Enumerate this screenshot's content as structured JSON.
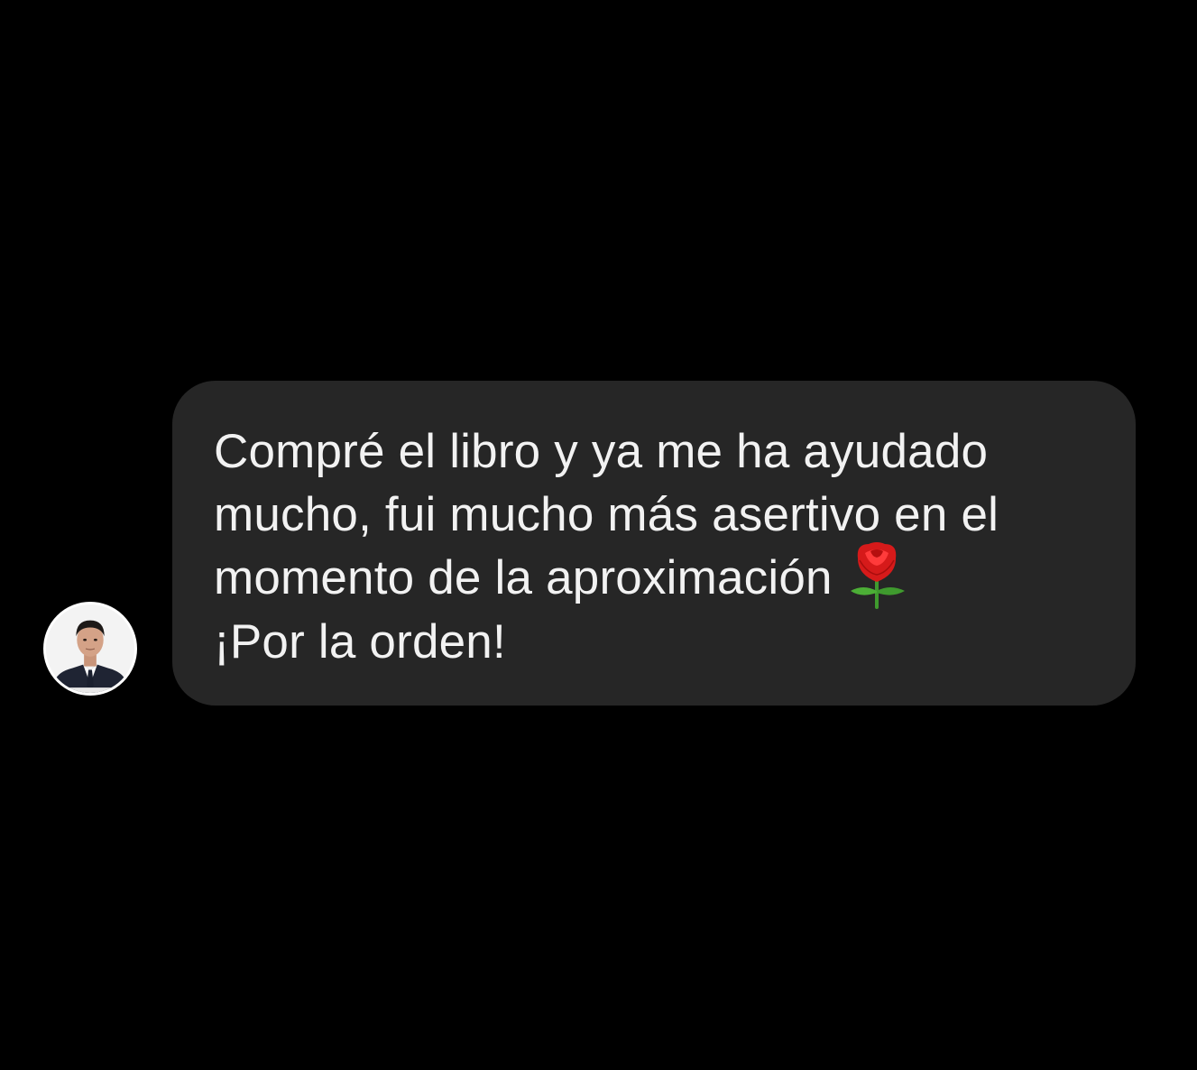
{
  "conversation": {
    "message": {
      "lines": [
        "Compré el libro y ya me ha ayudado",
        "mucho, fui mucho más asertivo en el",
        "momento de la aproximación",
        "¡Por la orden!"
      ],
      "emoji": "rose-icon"
    },
    "sender": {
      "avatar_icon": "profile-photo-avatar"
    }
  },
  "colors": {
    "background": "#000000",
    "bubble": "#262626",
    "text": "#f2f2f2"
  }
}
